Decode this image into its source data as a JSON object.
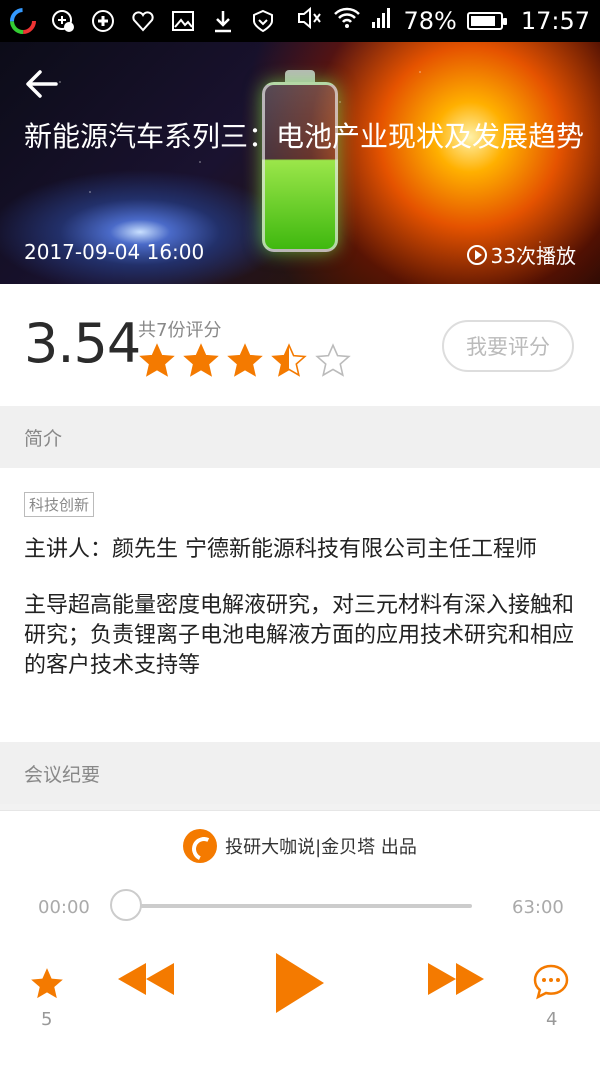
{
  "status_bar": {
    "battery_percent": "78%",
    "time": "17:57",
    "icons": [
      "app-icon",
      "shield-x-icon",
      "plus-circle-icon",
      "heart-x-icon",
      "image-icon",
      "download-icon",
      "vpn-shield-icon",
      "mute-icon",
      "wifi-icon",
      "signal-icon",
      "battery-icon"
    ]
  },
  "hero": {
    "title": "新能源汽车系列三：电池产业现状及发展趋势",
    "date": "2017-09-04 16:00",
    "plays": "33次播放"
  },
  "rating": {
    "score": "3.54",
    "count_label": "共7份评分",
    "stars_filled": 3.5,
    "stars_total": 5,
    "rate_button": "我要评分"
  },
  "sections": {
    "intro_header": "简介",
    "minutes_header": "会议纪要"
  },
  "intro": {
    "tag": "科技创新",
    "speaker": "主讲人：颜先生 宁德新能源科技有限公司主任工程师",
    "description": "主导超高能量密度电解液研究，对三元材料有深入接触和研究；负责锂离子电池电解液方面的应用技术研究和相应的客户技术支持等"
  },
  "player": {
    "producer": "投研大咖说|金贝塔 出品",
    "time_current": "00:00",
    "time_total": "63:00",
    "progress": 0,
    "favorite_count": "5",
    "comment_count": "4"
  },
  "colors": {
    "accent": "#f47a00",
    "star": "#f47a00",
    "section_bg": "#f0f0f0"
  }
}
